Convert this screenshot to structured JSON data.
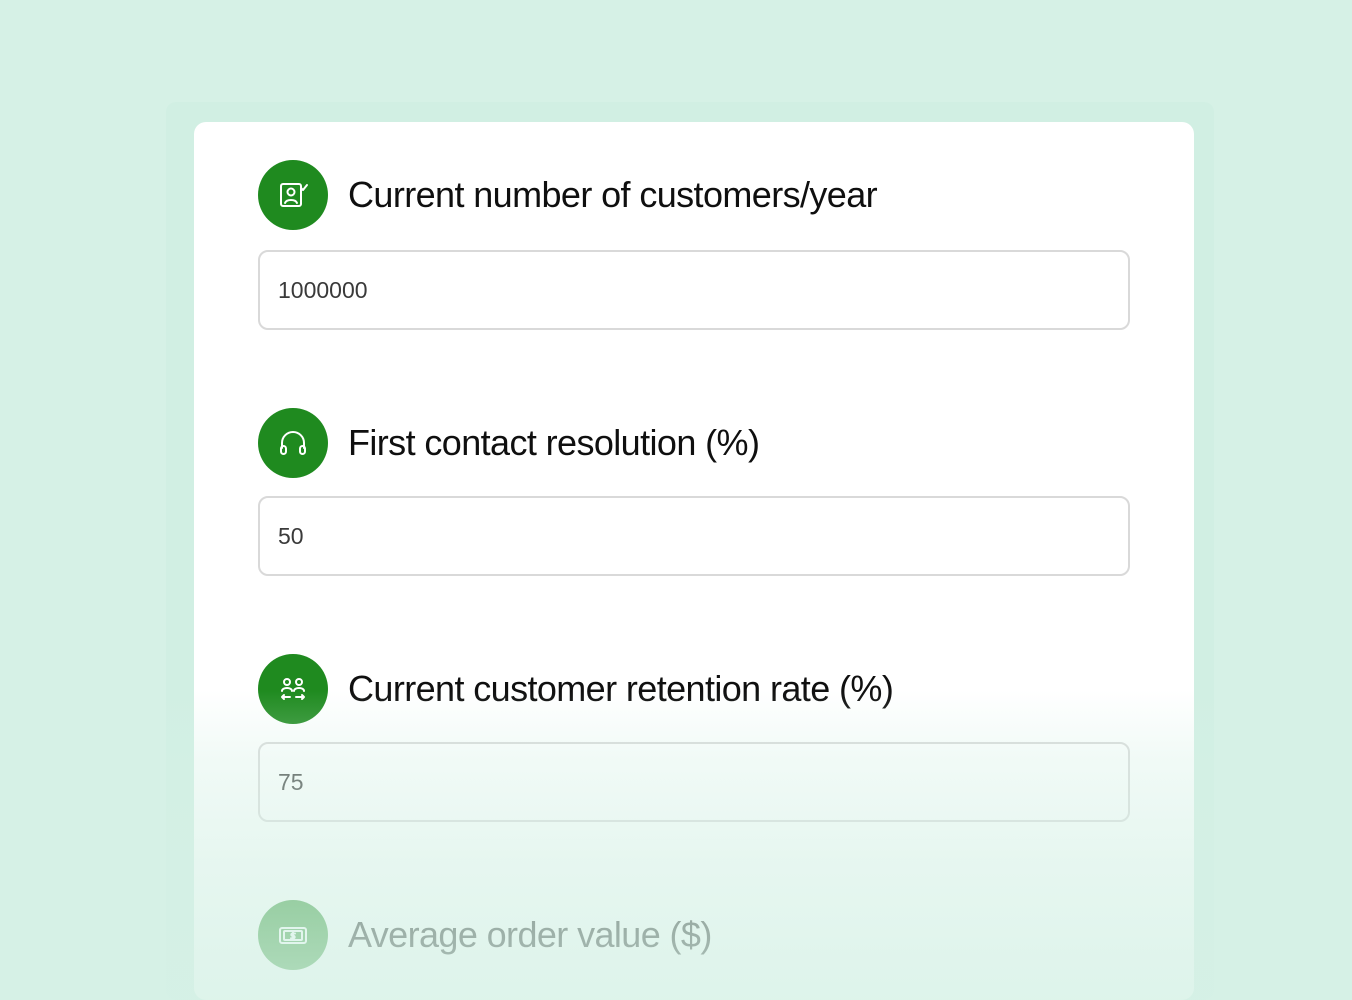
{
  "colors": {
    "page_background": "#d6f1e6",
    "card_background": "#ffffff",
    "accent_green": "#1f8a1f",
    "label_text": "#0f0f0f",
    "input_border": "#d9d9d9"
  },
  "form": {
    "fields": [
      {
        "label": "Current number of customers/year",
        "icon": "customer-card-icon",
        "value": "1000000"
      },
      {
        "label": "First contact resolution (%)",
        "icon": "headset-icon",
        "value": "50"
      },
      {
        "label": "Current customer retention rate (%)",
        "icon": "customer-exchange-icon",
        "value": "75"
      },
      {
        "label": "Average order value ($)",
        "icon": "cash-icon"
      }
    ]
  }
}
